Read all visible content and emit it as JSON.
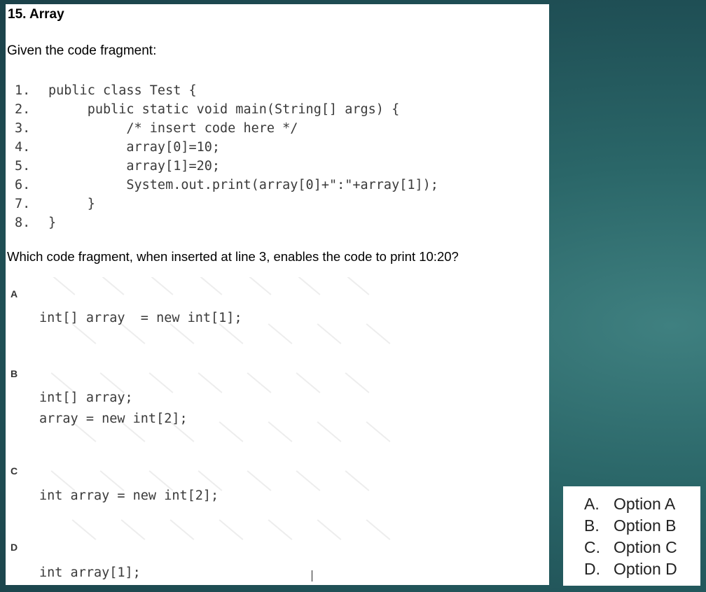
{
  "question": {
    "title": "15. Array",
    "intro": "Given the code fragment:",
    "code_lines": [
      {
        "num": "1.",
        "text": "public class Test {"
      },
      {
        "num": "2.",
        "text": "     public static void main(String[] args) {"
      },
      {
        "num": "3.",
        "text": "          /* insert code here */"
      },
      {
        "num": "4.",
        "text": "          array[0]=10;"
      },
      {
        "num": "5.",
        "text": "          array[1]=20;"
      },
      {
        "num": "6.",
        "text": "          System.out.print(array[0]+\":\"+array[1]);"
      },
      {
        "num": "7.",
        "text": "     }"
      },
      {
        "num": "8.",
        "text": "}"
      }
    ],
    "prompt": "Which code fragment, when inserted at line 3, enables the code to print 10:20?",
    "options": [
      {
        "letter": "A",
        "code": [
          "int[] array  = new int[1];"
        ]
      },
      {
        "letter": "B",
        "code": [
          "int[] array;",
          "array = new int[2];"
        ]
      },
      {
        "letter": "C",
        "code": [
          "int array = new int[2];"
        ]
      },
      {
        "letter": "D",
        "code": [
          "int array[1];"
        ]
      }
    ]
  },
  "answers": [
    {
      "letter": "A.",
      "label": "Option A"
    },
    {
      "letter": "B.",
      "label": "Option B"
    },
    {
      "letter": "C.",
      "label": "Option C"
    },
    {
      "letter": "D.",
      "label": "Option D"
    }
  ]
}
